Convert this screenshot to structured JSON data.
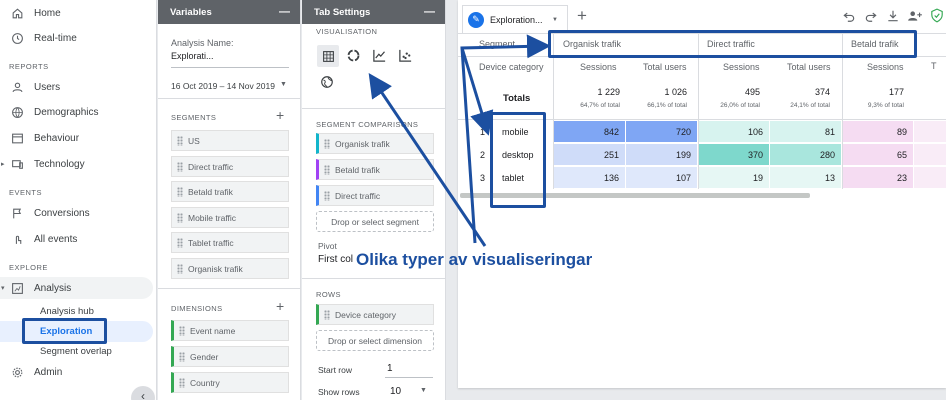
{
  "nav": {
    "home": "Home",
    "realtime": "Real-time",
    "section_reports": "REPORTS",
    "users": "Users",
    "demographics": "Demographics",
    "behaviour": "Behaviour",
    "technology": "Technology",
    "section_events": "EVENTS",
    "conversions": "Conversions",
    "all_events": "All events",
    "section_explore": "EXPLORE",
    "analysis": "Analysis",
    "analysis_hub": "Analysis hub",
    "exploration": "Exploration",
    "segment_overlap": "Segment overlap",
    "admin": "Admin"
  },
  "variables": {
    "header": "Variables",
    "analysis_name_label": "Analysis Name:",
    "analysis_name_value": "Explorati...",
    "date_range": "16 Oct 2019 – 14 Nov 2019",
    "segments_label": "SEGMENTS",
    "segments": [
      "US",
      "Direct traffic",
      "Betald trafik",
      "Mobile traffic",
      "Tablet traffic",
      "Organisk trafik"
    ],
    "dimensions_label": "DIMENSIONS",
    "dimensions": [
      "Event name",
      "Gender",
      "Country"
    ]
  },
  "tab_settings": {
    "header": "Tab Settings",
    "visualisation_label": "VISUALISATION",
    "segment_comparisons_label": "SEGMENT COMPARISONS",
    "segment_comparisons": [
      "Organisk trafik",
      "Betald trafik",
      "Direct traffic"
    ],
    "drop_segment": "Drop or select segment",
    "pivot_label": "Pivot",
    "pivot_value": "First col",
    "rows_label": "ROWS",
    "rows_item": "Device category",
    "drop_dimension": "Drop or select dimension",
    "start_row_label": "Start row",
    "start_row_value": "1",
    "show_rows_label": "Show rows",
    "show_rows_value": "10"
  },
  "report": {
    "tab_name": "Exploration...",
    "add_tab": "+",
    "segment_label": "Segment",
    "segments": [
      "Organisk trafik",
      "Direct traffic",
      "Betald trafik"
    ],
    "device_category_label": "Device category",
    "col_headers": [
      "Sessions",
      "Total users",
      "Sessions",
      "Total users",
      "Sessions"
    ],
    "totals_label": "Totals",
    "totals": [
      "1 229",
      "1 026",
      "495",
      "374",
      "177"
    ],
    "totals_pct": [
      "64,7% of total",
      "66,1% of total",
      "26,0% of total",
      "24,1% of total",
      "9,3% of total"
    ],
    "rows": [
      {
        "index": "1",
        "device": "mobile",
        "values": [
          "842",
          "720",
          "106",
          "81",
          "89"
        ]
      },
      {
        "index": "2",
        "device": "desktop",
        "values": [
          "251",
          "199",
          "370",
          "280",
          "65"
        ]
      },
      {
        "index": "3",
        "device": "tablet",
        "values": [
          "136",
          "107",
          "19",
          "13",
          "23"
        ]
      }
    ]
  },
  "annotation": {
    "label": "Olika typer av visualiseringar"
  },
  "colors": {
    "annotation": "#1c4fa0",
    "heat_blue_strong": "#7fa6f4",
    "heat_blue_light": "#cfdcf9",
    "heat_teal_strong": "#7ed8cc",
    "heat_teal_light": "#d7f3ef",
    "heat_pink_light": "#f5dcf2"
  }
}
